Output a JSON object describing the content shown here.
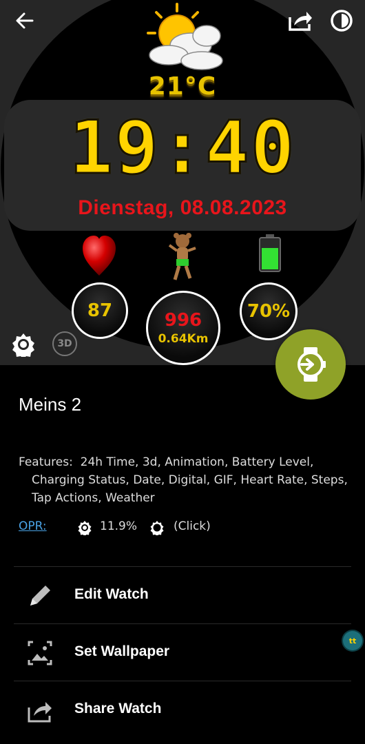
{
  "watch": {
    "temperature": "21°C",
    "time": "19:40",
    "date": "Dienstag,  08.08.2023",
    "heart_rate": "87",
    "steps": "996",
    "distance": "0.64Km",
    "battery": "70%",
    "badge_3d": "3D"
  },
  "details": {
    "title": "Meins 2",
    "features_label": "Features:",
    "features_line1": "24h Time,  3d,  Animation,  Battery Level,",
    "features_line2": "Charging Status,  Date,  Digital,  GIF,  Heart Rate,  Steps,",
    "features_line3": "Tap Actions,  Weather",
    "opr_label": "OPR:",
    "opr_value": "11.9%",
    "opr_click": "(Click)"
  },
  "menu": {
    "edit": "Edit Watch",
    "wallpaper": "Set Wallpaper",
    "share": "Share Watch"
  },
  "side_bubble": "tt",
  "colors": {
    "accent_green": "#8fa228",
    "digit_yellow": "#ffd400",
    "date_red": "#e8151b",
    "link_blue": "#4aa3e6"
  }
}
